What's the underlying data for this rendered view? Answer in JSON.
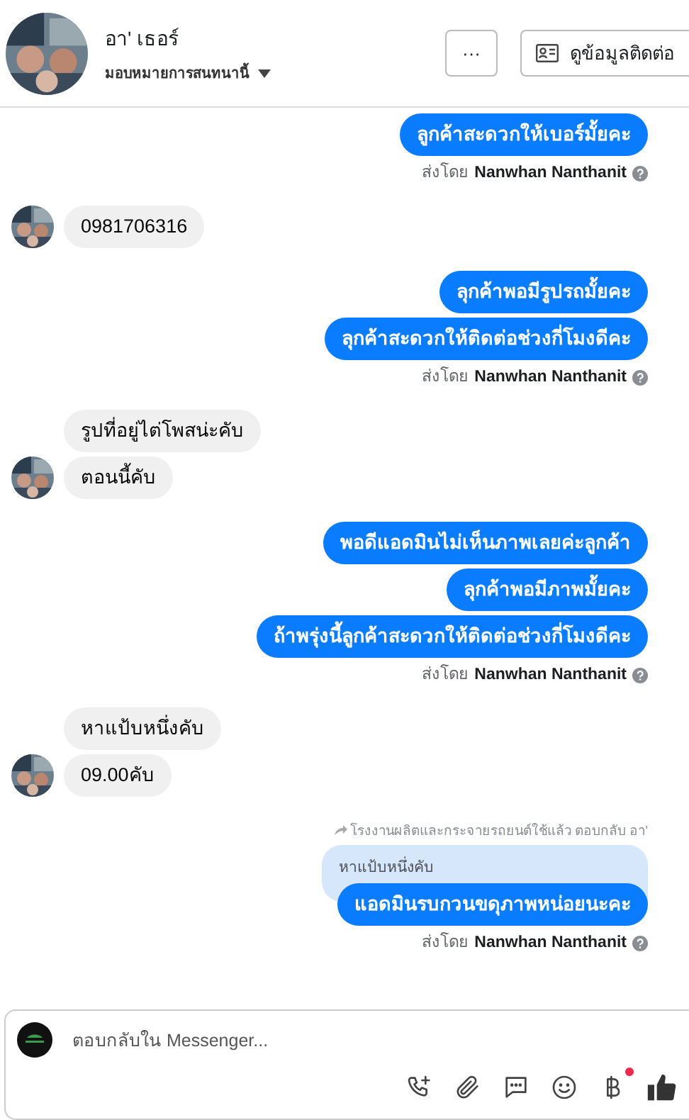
{
  "header": {
    "name": "อา' เธอร์",
    "assign_label": "มอบหมายการสนทนานี้",
    "more_button": "···",
    "contact_button": "ดูข้อมูลติดต่อ"
  },
  "groups": [
    {
      "kind": "outgoing",
      "messages": [
        "ลูกค้าสะดวกให้เบอร์มั้ยคะ"
      ],
      "sent_by": "ส่งโดย",
      "sender": "Nanwhan Nanthanit"
    },
    {
      "kind": "incoming",
      "messages": [
        "0981706316"
      ]
    },
    {
      "kind": "outgoing",
      "messages": [
        "ลุกค้าพอมีรูปรถมั้ยคะ",
        "ลุกค้าสะดวกให้ติดต่อช่วงกี่โมงดีคะ"
      ],
      "sent_by": "ส่งโดย",
      "sender": "Nanwhan Nanthanit"
    },
    {
      "kind": "incoming",
      "messages": [
        "รูปที่อยู่ไต่โพสน่ะคับ",
        "ตอนนี้คับ"
      ]
    },
    {
      "kind": "outgoing",
      "messages": [
        "พอดีแอดมินไม่เห็นภาพเลยค่ะลูกค้า",
        "ลุกค้าพอมีภาพมั้ยคะ",
        "ถ้าพรุ่งนี้ลูกค้าสะดวกให้ติดต่อช่วงกี่โมงดีคะ"
      ],
      "sent_by": "ส่งโดย",
      "sender": "Nanwhan Nanthanit"
    },
    {
      "kind": "incoming",
      "messages": [
        "หาแป้บหนึ่งคับ",
        "09.00คับ"
      ]
    },
    {
      "kind": "reply",
      "reply_note": "โรงงานผลิตและกระจายรถยนต์ใช้แล้ว ตอบกลับ อา'",
      "quoted": "หาแป้บหนึ่งคับ",
      "messages": [
        "แอดมินรบกวนขดุภาพหน่อยนะคะ"
      ],
      "sent_by": "ส่งโดย",
      "sender": "Nanwhan Nanthanit"
    }
  ],
  "composer": {
    "placeholder": "ตอบกลับใน Messenger...",
    "notification_dot": true
  }
}
